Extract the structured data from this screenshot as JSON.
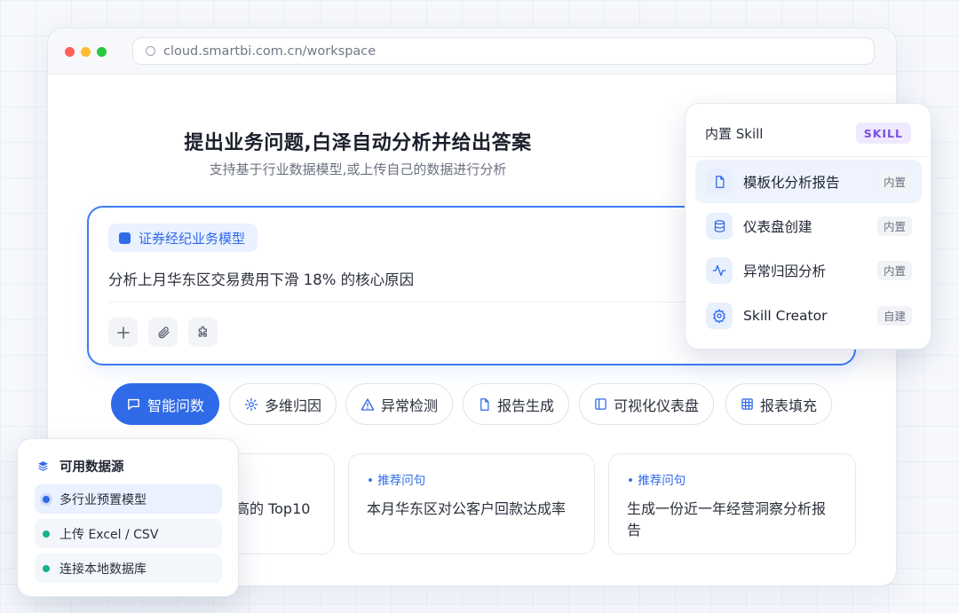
{
  "browser": {
    "url": "cloud.smartbi.com.cn/workspace"
  },
  "hero": {
    "title": "提出业务问题,白泽自动分析并给出答案",
    "subtitle": "支持基于行业数据模型,或上传自己的数据进行分析"
  },
  "query": {
    "model_chip": "证券经纪业务模型",
    "text": "分析上月华东区交易费用下滑 18% 的核心原因"
  },
  "tabs": [
    {
      "label": "智能问数",
      "icon": "chat-icon",
      "active": true
    },
    {
      "label": "多维归因",
      "icon": "sun-icon"
    },
    {
      "label": "异常检测",
      "icon": "warning-icon"
    },
    {
      "label": "报告生成",
      "icon": "document-icon"
    },
    {
      "label": "可视化仪表盘",
      "icon": "panel-icon"
    },
    {
      "label": "报表填充",
      "icon": "grid-icon"
    }
  ],
  "cards": [
    {
      "tag": "",
      "text": "高的 Top10"
    },
    {
      "tag": "• 推荐问句",
      "text": "本月华东区对公客户回款达成率"
    },
    {
      "tag": "• 推荐问句",
      "text": "生成一份近一年经营洞察分析报告"
    }
  ],
  "skills": {
    "title": "内置 Skill",
    "badge": "SKILL",
    "items": [
      {
        "name": "模板化分析报告",
        "tag": "内置",
        "icon": "document-icon"
      },
      {
        "name": "仪表盘创建",
        "tag": "内置",
        "icon": "database-icon"
      },
      {
        "name": "异常归因分析",
        "tag": "内置",
        "icon": "pulse-icon"
      },
      {
        "name": "Skill Creator",
        "tag": "自建",
        "icon": "gear-icon"
      }
    ]
  },
  "datasource": {
    "title": "可用数据源",
    "items": [
      {
        "label": "多行业预置模型",
        "selected": true
      },
      {
        "label": "上传 Excel / CSV"
      },
      {
        "label": "连接本地数据库"
      }
    ]
  },
  "colors": {
    "accent": "#2f6ae8",
    "skill_badge": "#7a4ee6",
    "status_green": "#14b38a"
  }
}
